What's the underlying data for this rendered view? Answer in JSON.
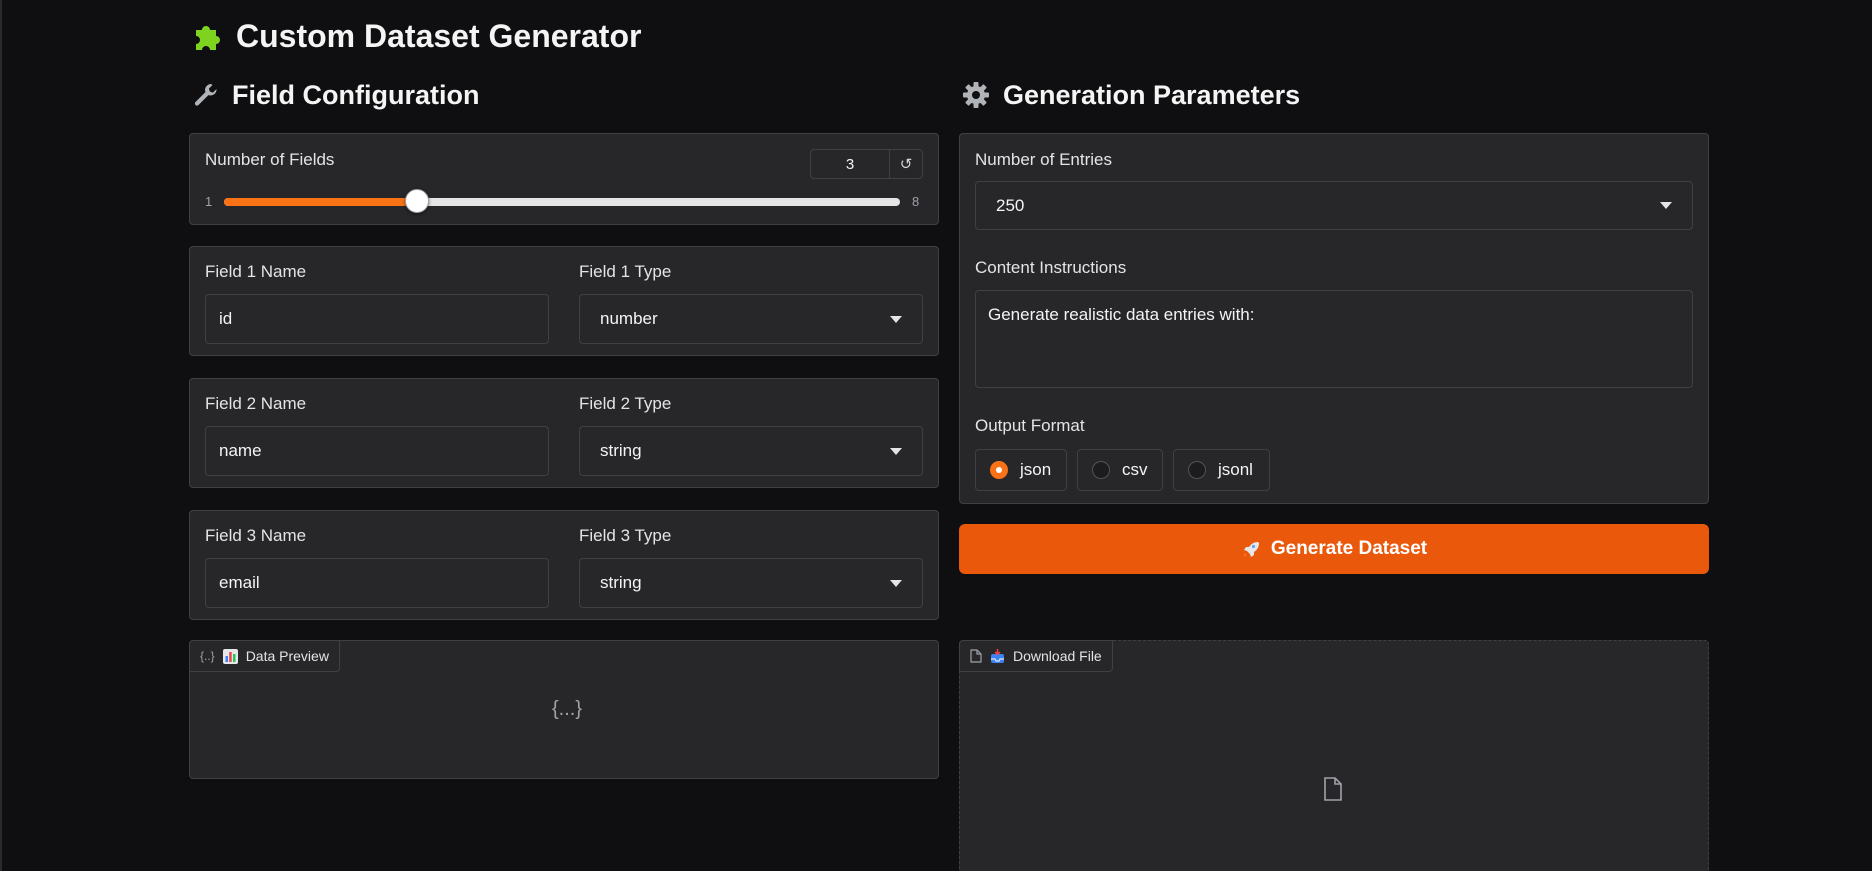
{
  "app": {
    "title": "Custom Dataset Generator",
    "title_icon": "puzzle-icon"
  },
  "field_config": {
    "title": "Field Configuration",
    "icon": "wrench-icon",
    "num_fields": {
      "label": "Number of Fields",
      "value": "3",
      "min": "1",
      "max": "8",
      "reset_glyph": "↺",
      "fraction": 0.2857
    },
    "fields": [
      {
        "name_label": "Field 1 Name",
        "name_value": "id",
        "type_label": "Field 1 Type",
        "type_value": "number"
      },
      {
        "name_label": "Field 2 Name",
        "name_value": "name",
        "type_label": "Field 2 Type",
        "type_value": "string"
      },
      {
        "name_label": "Field 3 Name",
        "name_value": "email",
        "type_label": "Field 3 Type",
        "type_value": "string"
      }
    ]
  },
  "gen_params": {
    "title": "Generation Parameters",
    "icon": "gear-icon",
    "entries": {
      "label": "Number of Entries",
      "value": "250"
    },
    "instructions": {
      "label": "Content Instructions",
      "value": "Generate realistic data entries with:"
    },
    "output_format": {
      "label": "Output Format",
      "options": [
        "json",
        "csv",
        "jsonl"
      ],
      "selected": "json"
    },
    "generate_label": "Generate Dataset",
    "generate_icon": "rocket-icon"
  },
  "preview": {
    "label": "Data Preview",
    "tag_glyph": "{..}",
    "empty_glyph": "{...}"
  },
  "download": {
    "label": "Download File"
  },
  "colors": {
    "accent": "#f97316",
    "button": "#ea580c",
    "background": "#0f0f11",
    "panel": "#27272a"
  }
}
